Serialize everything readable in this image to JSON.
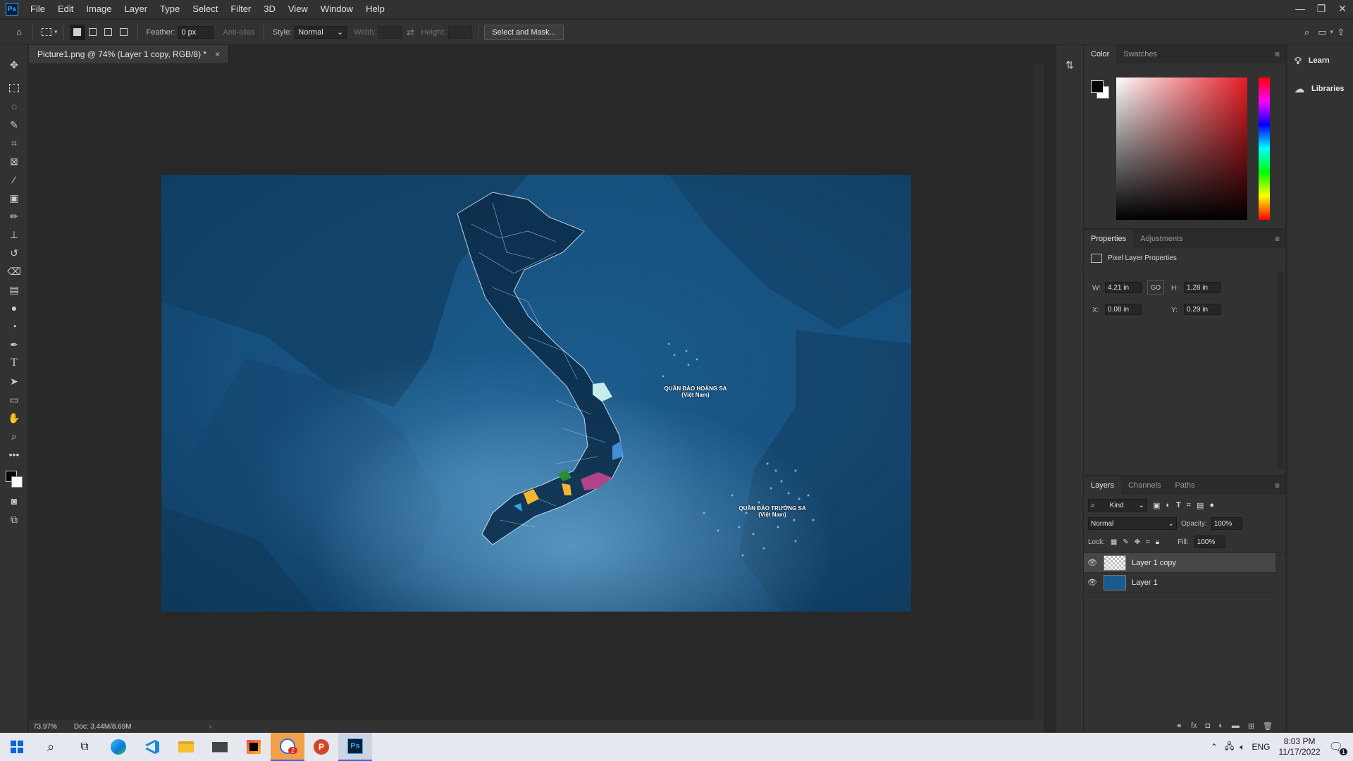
{
  "app": {
    "logo_text": "Ps"
  },
  "menu": [
    "File",
    "Edit",
    "Image",
    "Layer",
    "Type",
    "Select",
    "Filter",
    "3D",
    "View",
    "Window",
    "Help"
  ],
  "window_controls": {
    "minimize": "—",
    "restore": "❐",
    "close": "✕"
  },
  "options": {
    "feather_label": "Feather:",
    "feather_value": "0 px",
    "antialias_label": "Anti-alias",
    "style_label": "Style:",
    "style_value": "Normal",
    "width_label": "Width:",
    "height_label": "Height:",
    "select_mask_label": "Select and Mask..."
  },
  "document": {
    "tab_title": "Picture1.png @ 74% (Layer 1 copy, RGB/8) *",
    "zoom": "73.97%",
    "doc_size": "Doc: 3.44M/8.69M"
  },
  "map": {
    "label1_line1": "QUẦN ĐẢO HOÀNG SA",
    "label1_line2": "(Việt Nam)",
    "label2_line1": "QUẦN ĐẢO TRƯỜNG SA",
    "label2_line2": "(Việt Nam)"
  },
  "color_panel": {
    "tabs": [
      "Color",
      "Swatches"
    ]
  },
  "properties_panel": {
    "tabs": [
      "Properties",
      "Adjustments"
    ],
    "header": "Pixel Layer Properties",
    "w_label": "W:",
    "w_value": "4.21 in",
    "h_label": "H:",
    "h_value": "1.28 in",
    "x_label": "X:",
    "x_value": "0.08 in",
    "y_label": "Y:",
    "y_value": "0.29 in",
    "link_label": "GO"
  },
  "layers_panel": {
    "tabs": [
      "Layers",
      "Channels",
      "Paths"
    ],
    "filter_kind": "Kind",
    "blend_mode": "Normal",
    "opacity_label": "Opacity:",
    "opacity_value": "100%",
    "lock_label": "Lock:",
    "fill_label": "Fill:",
    "fill_value": "100%",
    "layers": [
      {
        "name": "Layer 1 copy"
      },
      {
        "name": "Layer 1"
      }
    ]
  },
  "learn_panel": {
    "learn": "Learn",
    "libraries": "Libraries"
  },
  "tray": {
    "lang": "ENG",
    "time": "8:03 PM",
    "date": "11/17/2022",
    "notification_count": "1",
    "outlook_badge": "2"
  },
  "colors": {
    "accent": "#31a8ff",
    "selection_bg": "#474747"
  }
}
